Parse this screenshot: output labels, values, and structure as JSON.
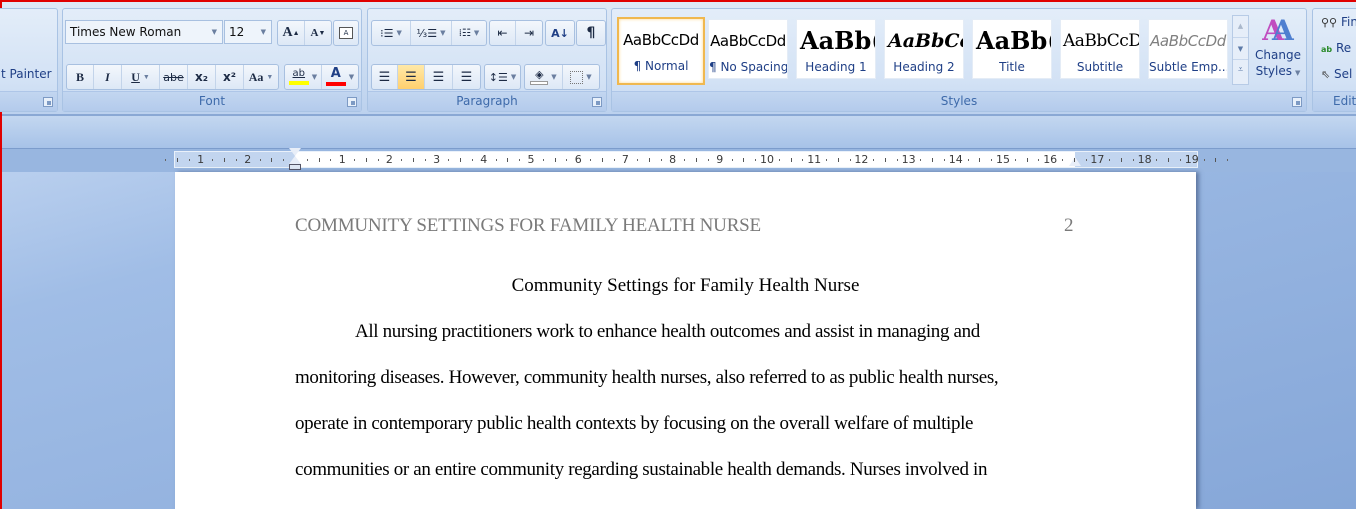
{
  "ribbon": {
    "clipboard": {
      "format_painter_label": "t Painter"
    },
    "font": {
      "group_label": "Font",
      "font_name": "Times New Roman",
      "font_size": "12",
      "grow_font": "A",
      "shrink_font": "A",
      "bold": "B",
      "italic": "I",
      "underline": "U",
      "strikethrough": "abe",
      "subscript": "x₂",
      "superscript": "x²",
      "change_case": "Aa",
      "highlight": "ab",
      "font_color": "A",
      "highlight_color": "#ffff00",
      "font_color_value": "#ff0000"
    },
    "paragraph": {
      "group_label": "Paragraph",
      "sort": "A↓",
      "show_marks": "¶",
      "active_alignment": "center"
    },
    "styles": {
      "group_label": "Styles",
      "items": [
        {
          "sample": "AaBbCcDd",
          "name": "¶ Normal",
          "selected": true
        },
        {
          "sample": "AaBbCcDd",
          "name": "¶ No Spacing",
          "selected": false
        },
        {
          "sample": "AaBb(",
          "name": "Heading 1",
          "selected": false
        },
        {
          "sample": "AaBbCc",
          "name": "Heading 2",
          "selected": false
        },
        {
          "sample": "AaBb(",
          "name": "Title",
          "selected": false
        },
        {
          "sample": "AaBbCcD",
          "name": "Subtitle",
          "selected": false
        },
        {
          "sample": "AaBbCcDd",
          "name": "Subtle Emp...",
          "selected": false
        }
      ],
      "change_styles_line1": "Change",
      "change_styles_line2": "Styles"
    },
    "editing": {
      "group_label": "Editi",
      "find": "Fin",
      "replace": "Re",
      "select": "Sel"
    }
  },
  "ruler": {
    "left_numbers": [
      "2",
      "1"
    ],
    "right_numbers": [
      "1",
      "2",
      "3",
      "4",
      "5",
      "6",
      "7",
      "8",
      "9",
      "10",
      "11",
      "12",
      "13",
      "14",
      "15",
      "16",
      "17",
      "18",
      "19"
    ]
  },
  "document": {
    "header": "COMMUNITY SETTINGS FOR FAMILY HEALTH NURSE",
    "page_number": "2",
    "title": "Community Settings for Family Health Nurse",
    "lines": [
      "All nursing practitioners work to enhance health outcomes and assist in managing and",
      "monitoring diseases. However,  community health nurses, also referred to as public health nurses,",
      "operate in contemporary public health contexts by focusing on the overall welfare of multiple",
      "communities or an entire community regarding sustainable health demands. Nurses involved in"
    ]
  }
}
